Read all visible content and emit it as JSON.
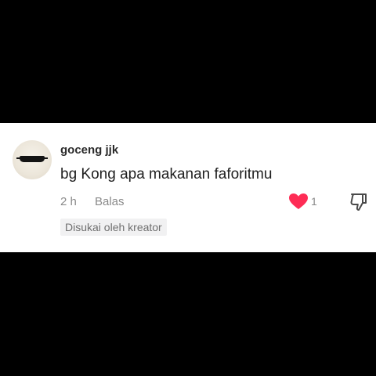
{
  "comment": {
    "username": "goceng jjk",
    "text": "bg Kong apa makanan faforitmu",
    "timestamp": "2 h",
    "reply_label": "Balas",
    "like_count": "1",
    "liked": true,
    "creator_badge": "Disukai oleh kreator",
    "icons": {
      "avatar": "avatar-sunglasses",
      "like": "heart-icon",
      "dislike": "thumbs-down-icon"
    }
  },
  "colors": {
    "letterbox": "#000000",
    "card_background": "#ffffff",
    "heart": "#fe2c55",
    "muted_text": "#8a8a8a",
    "badge_background": "#f1f1f2"
  }
}
